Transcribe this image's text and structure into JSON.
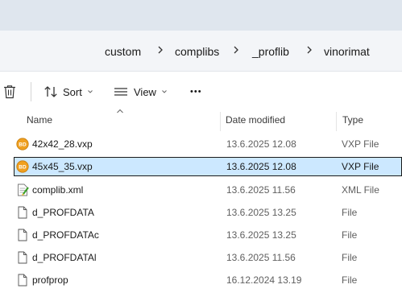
{
  "window": {
    "breadcrumb": [
      {
        "label": "custom"
      },
      {
        "label": "complibs"
      },
      {
        "label": "_proflib"
      },
      {
        "label": "vinorimat"
      }
    ]
  },
  "toolbar": {
    "delete_icon": "trash-icon",
    "sort_label": "Sort",
    "view_label": "View",
    "more_label": "•••"
  },
  "columns": {
    "name": "Name",
    "date_modified": "Date modified",
    "type": "Type"
  },
  "files": [
    {
      "name": "42x42_28.vxp",
      "date": "13.6.2025 12.08",
      "type": "VXP File",
      "icon": "vxp-file-icon",
      "selected": false
    },
    {
      "name": "45x45_35.vxp",
      "date": "13.6.2025 12.08",
      "type": "VXP File",
      "icon": "vxp-file-icon",
      "selected": true
    },
    {
      "name": "complib.xml",
      "date": "13.6.2025 11.56",
      "type": "XML File",
      "icon": "xml-file-icon",
      "selected": false
    },
    {
      "name": "d_PROFDATA",
      "date": "13.6.2025 13.25",
      "type": "File",
      "icon": "generic-file-icon",
      "selected": false
    },
    {
      "name": "d_PROFDATAc",
      "date": "13.6.2025 13.25",
      "type": "File",
      "icon": "generic-file-icon",
      "selected": false
    },
    {
      "name": "d_PROFDATAl",
      "date": "13.6.2025 11.56",
      "type": "File",
      "icon": "generic-file-icon",
      "selected": false
    },
    {
      "name": "profprop",
      "date": "16.12.2024 13.19",
      "type": "File",
      "icon": "generic-file-icon",
      "selected": false
    }
  ],
  "colors": {
    "selection_bg": "#cce8ff",
    "vxp_icon": "#f0a020"
  }
}
